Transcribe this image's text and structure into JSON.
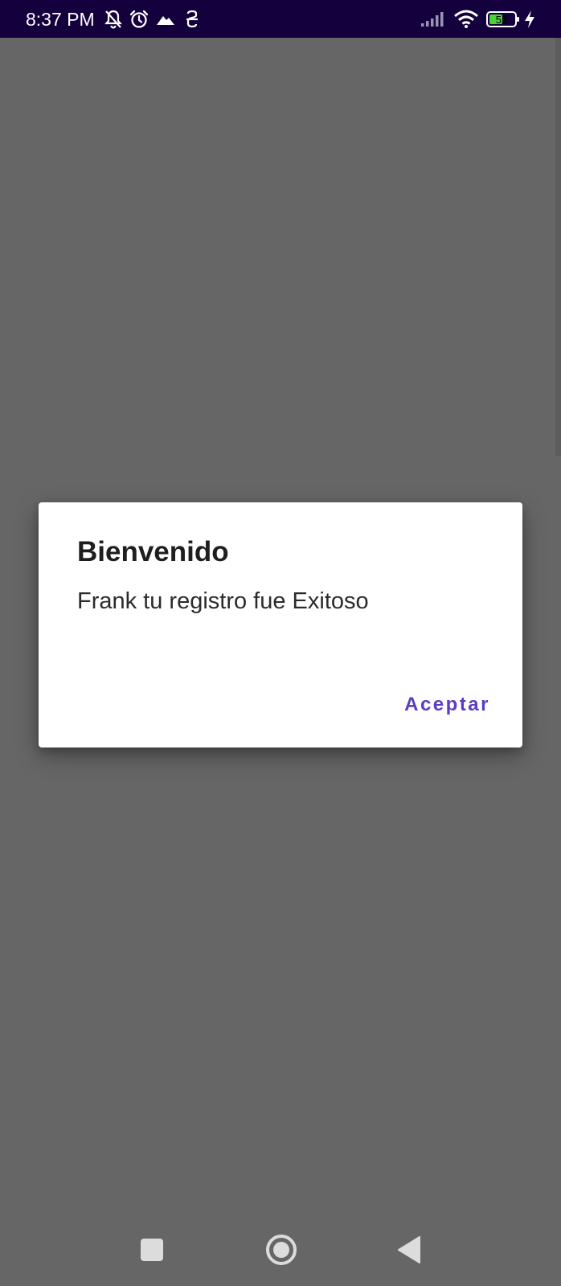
{
  "status_bar": {
    "time": "8:37 PM",
    "battery_level": "52",
    "icons": [
      "notifications-off-icon",
      "alarm-icon",
      "mountain-icon",
      "vpn-key-icon",
      "signal-icon",
      "wifi-icon",
      "battery-icon",
      "charging-icon"
    ],
    "background_color": "#13003d"
  },
  "dialog": {
    "title": "Bienvenido",
    "message": "Frank tu registro fue Exitoso",
    "positive_button": "Aceptar",
    "accent_color": "#5b3cc4"
  },
  "nav_bar": {
    "buttons": [
      "recents-button",
      "home-button",
      "back-button"
    ]
  }
}
